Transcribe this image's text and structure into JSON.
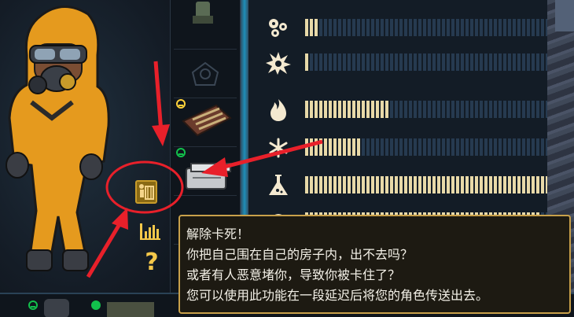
{
  "tooltip": {
    "title": "解除卡死！",
    "lines": [
      "你把自己围在自己的房子内，出不去吗？",
      "或者有人恶意堵你，导致你被卡住了？",
      "您可以使用此功能在一段延迟后将您的角色传送出去。"
    ]
  },
  "help_label": "?",
  "stats": [
    {
      "icon": "bullet-resist-icon",
      "level": 3,
      "max": 66
    },
    {
      "icon": "explosion-resist-icon",
      "level": 1,
      "max": 66
    },
    {
      "icon": "heat-resist-icon",
      "level": 18,
      "max": 66
    },
    {
      "icon": "cold-resist-icon",
      "level": 12,
      "max": 66
    },
    {
      "icon": "radiation-resist-icon",
      "level": 62,
      "max": 66
    },
    {
      "icon": "bio-resist-icon",
      "level": 50,
      "max": 66
    }
  ],
  "colors": {
    "accent": "#f5c84a",
    "slot_indicator_yellow": "#ffd23a",
    "slot_indicator_green": "#12c14c",
    "annotation": "#e8202a",
    "bar_filled": "#e8d9a8",
    "bar_empty": "#263a50"
  }
}
